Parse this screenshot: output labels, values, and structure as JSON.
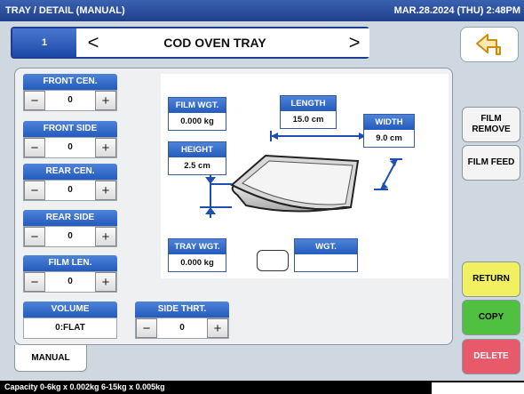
{
  "topbar": {
    "title": "TRAY / DETAIL (MANUAL)",
    "datetime": "MAR.28.2024 (THU)  2:48PM"
  },
  "header": {
    "number": "1",
    "prev": "<",
    "title": "COD OVEN TRAY",
    "next": ">"
  },
  "controls": [
    {
      "label": "FRONT CEN.",
      "value": "0"
    },
    {
      "label": "FRONT SIDE",
      "value": "0"
    },
    {
      "label": "REAR CEN.",
      "value": "0"
    },
    {
      "label": "REAR SIDE",
      "value": "0"
    },
    {
      "label": "FILM LEN.",
      "value": "0"
    }
  ],
  "volume": {
    "label": "VOLUME",
    "value": "0:FLAT"
  },
  "side_thrt": {
    "label": "SIDE THRT.",
    "value": "0"
  },
  "minus": "−",
  "plus": "+",
  "diagram": {
    "film_wgt": {
      "label": "FILM WGT.",
      "value": "0.000 kg"
    },
    "length": {
      "label": "LENGTH",
      "value": "15.0 cm"
    },
    "width": {
      "label": "WIDTH",
      "value": "9.0 cm"
    },
    "height": {
      "label": "HEIGHT",
      "value": "2.5 cm"
    },
    "tray_wgt": {
      "label": "TRAY WGT.",
      "value": "0.000 kg"
    },
    "wgt": {
      "label": "WGT.",
      "value": ""
    }
  },
  "side": {
    "film_remove": "FILM REMOVE",
    "film_feed": "FILM FEED",
    "return": "RETURN",
    "copy": "COPY",
    "delete": "DELETE"
  },
  "colors": {
    "return": "#f0f060",
    "copy": "#50c040",
    "delete": "#e85a6a",
    "accent": "#245bbd"
  },
  "tab": "MANUAL",
  "status": "Capacity 0-6kg x 0.002kg  6-15kg x 0.005kg"
}
